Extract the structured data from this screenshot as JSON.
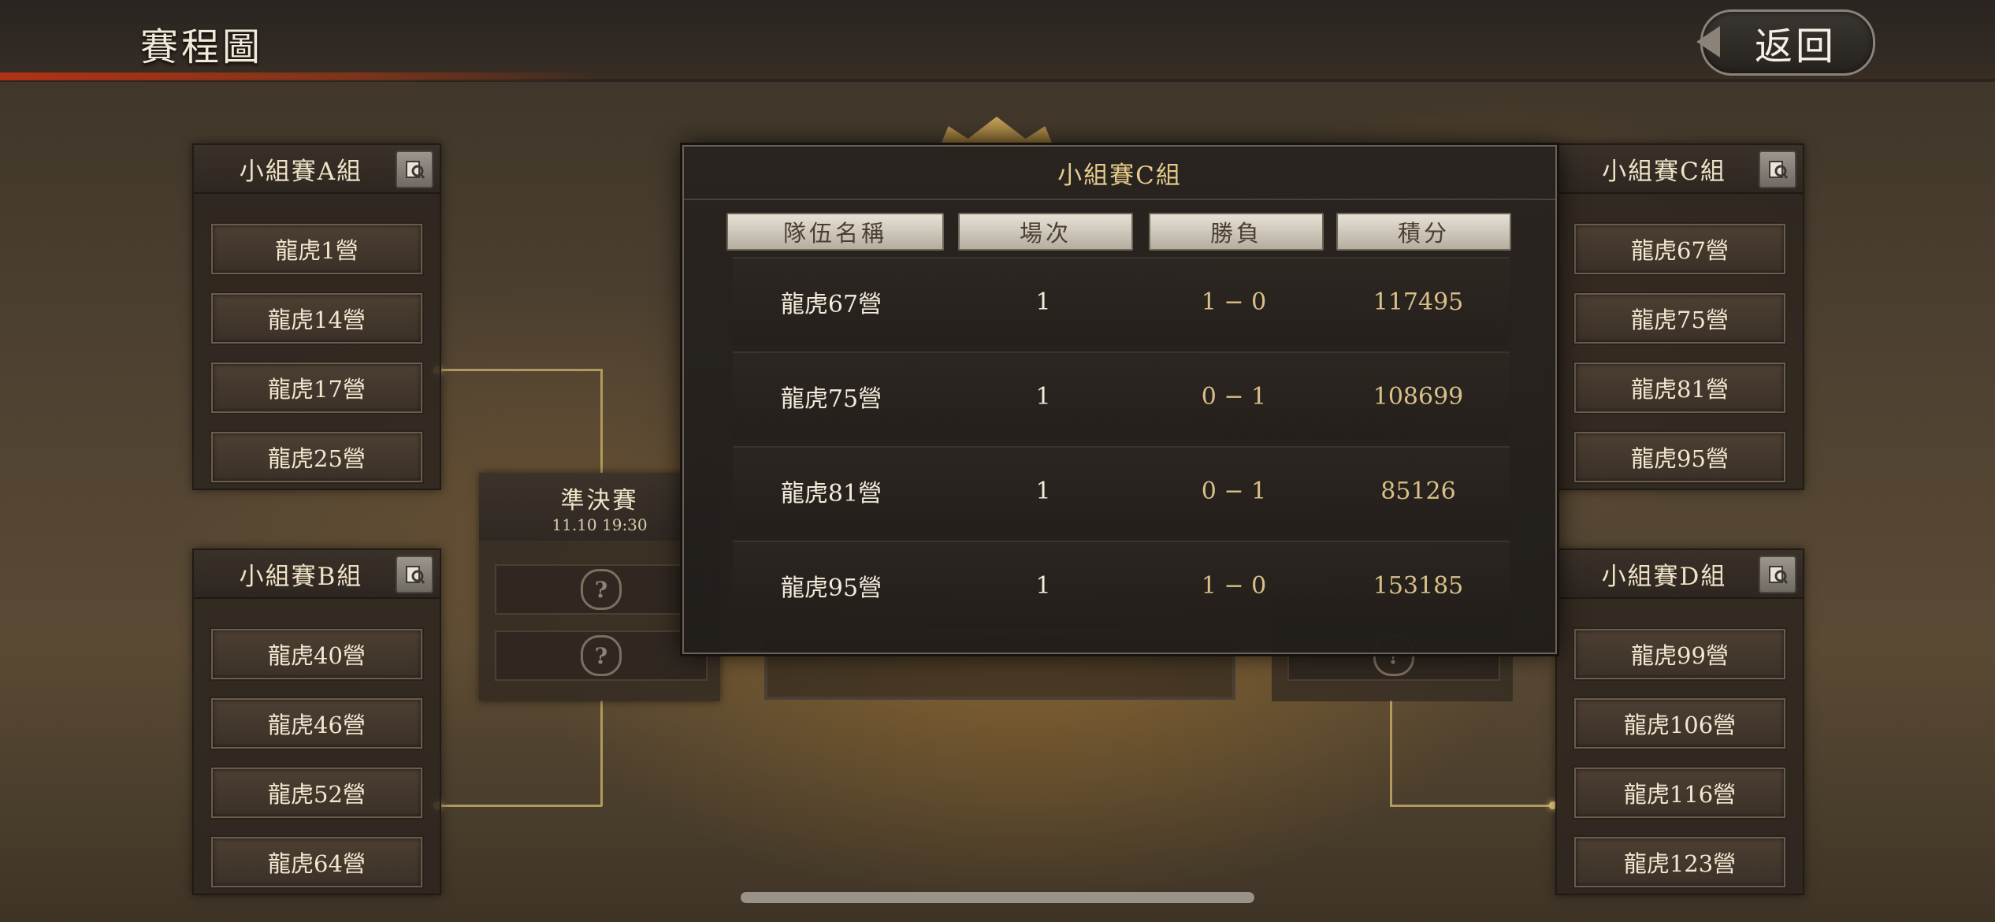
{
  "header": {
    "title": "賽程圖",
    "back_label": "返回"
  },
  "groups": {
    "A": {
      "title": "小組賽A組",
      "teams": [
        "龍虎1營",
        "龍虎14營",
        "龍虎17營",
        "龍虎25營"
      ]
    },
    "B": {
      "title": "小組賽B組",
      "teams": [
        "龍虎40營",
        "龍虎46營",
        "龍虎52營",
        "龍虎64營"
      ]
    },
    "C": {
      "title": "小組賽C組",
      "teams": [
        "龍虎67營",
        "龍虎75營",
        "龍虎81營",
        "龍虎95營"
      ]
    },
    "D": {
      "title": "小組賽D組",
      "teams": [
        "龍虎99營",
        "龍虎106營",
        "龍虎116營",
        "龍虎123營"
      ]
    }
  },
  "semifinal": {
    "title": "準決賽",
    "date": "11.10 19:30",
    "placeholder": "?"
  },
  "modal": {
    "title": "小組賽C組",
    "columns": [
      "隊伍名稱",
      "場次",
      "勝負",
      "積分"
    ],
    "rows": [
      {
        "name": "龍虎67營",
        "games": "1",
        "wl": "1 − 0",
        "points": "117495"
      },
      {
        "name": "龍虎75營",
        "games": "1",
        "wl": "0 − 1",
        "points": "108699"
      },
      {
        "name": "龍虎81營",
        "games": "1",
        "wl": "0 − 1",
        "points": "85126"
      },
      {
        "name": "龍虎95營",
        "games": "1",
        "wl": "1 − 0",
        "points": "153185"
      }
    ]
  },
  "icons": {
    "back": "back-arrow-icon",
    "view": "scroll-view-icon",
    "unknown": "question-mark-icon"
  }
}
